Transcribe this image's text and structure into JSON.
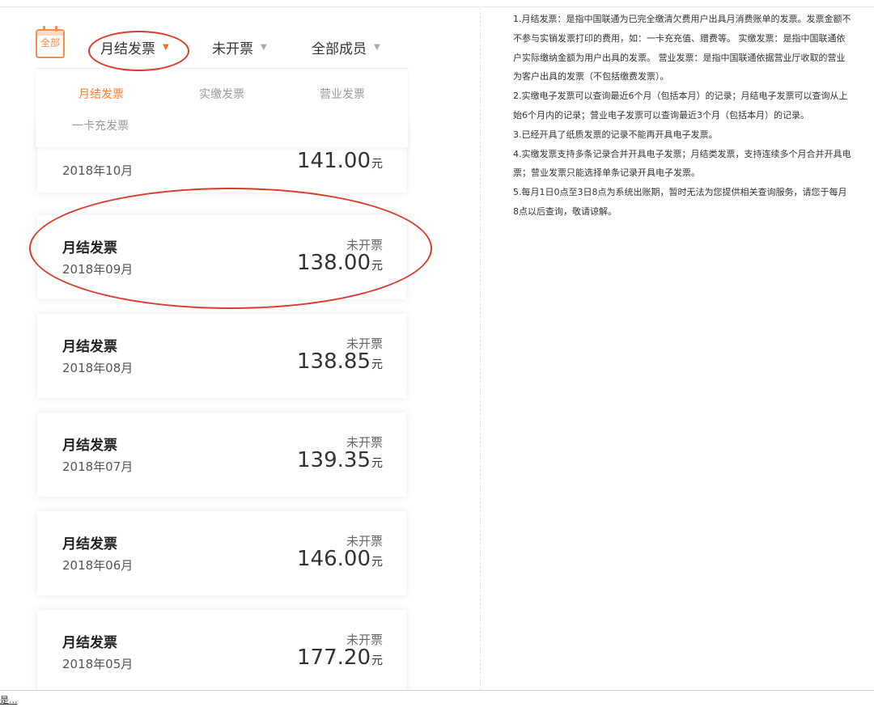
{
  "header": {
    "calendar_label": "全部",
    "filters": [
      "月结发票",
      "未开票",
      "全部成员"
    ]
  },
  "tabs": [
    "月结发票",
    "实缴发票",
    "营业发票",
    "一卡充发票"
  ],
  "cards": [
    {
      "title": "",
      "date": "2018年10月",
      "status": "",
      "amount": "141.00",
      "unit": "元"
    },
    {
      "title": "月结发票",
      "date": "2018年09月",
      "status": "未开票",
      "amount": "138.00",
      "unit": "元"
    },
    {
      "title": "月结发票",
      "date": "2018年08月",
      "status": "未开票",
      "amount": "138.85",
      "unit": "元"
    },
    {
      "title": "月结发票",
      "date": "2018年07月",
      "status": "未开票",
      "amount": "139.35",
      "unit": "元"
    },
    {
      "title": "月结发票",
      "date": "2018年06月",
      "status": "未开票",
      "amount": "146.00",
      "unit": "元"
    },
    {
      "title": "月结发票",
      "date": "2018年05月",
      "status": "未开票",
      "amount": "177.20",
      "unit": "元"
    }
  ],
  "notes": [
    "1.月结发票：是指中国联通为已完全缴清欠费用户出具月消费账单的发票。发票金额不",
    "不参与实销发票打印的费用，如：一卡充充值、赠费等。 实缴发票：是指中国联通依",
    "户实际缴纳金额为用户出具的发票。 营业发票：是指中国联通依据营业厅收取的营业",
    "为客户出具的发票（不包括缴费发票）。",
    "2.实缴电子发票可以查询最近6个月（包括本月）的记录；月结电子发票可以查询从上",
    "始6个月内的记录；营业电子发票可以查询最近3个月（包括本月）的记录。",
    "3.已经开具了纸质发票的记录不能再开具电子发票。",
    "4.实缴发票支持多条记录合并开具电子发票；月结类发票，支持连续多个月合并开具电",
    "票；营业发票只能选择单条记录开具电子发票。",
    "5.每月1日0点至3日8点为系统出账期，暂时无法为您提供相关查询服务，请您于每月",
    "8点以后查询，敬请谅解。"
  ],
  "statusbar": {
    "text": "是..."
  },
  "colors": {
    "accent": "#ff7f3a",
    "annotation": "#d93a2b"
  }
}
